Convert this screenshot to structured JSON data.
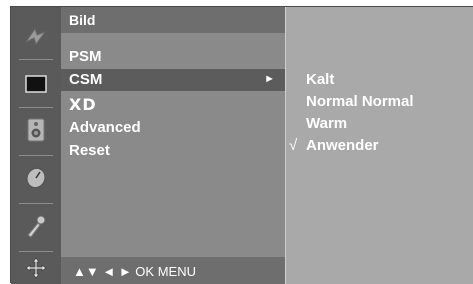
{
  "icons": [
    "picture-icon",
    "screen-icon",
    "audio-icon",
    "time-icon",
    "special-icon",
    "setup-icon"
  ],
  "menu": {
    "title": "Bild",
    "items": [
      {
        "label": "PSM",
        "selected": false,
        "arrow": ""
      },
      {
        "label": "CSM",
        "selected": true,
        "arrow": "►"
      },
      {
        "label": "XD",
        "selected": false,
        "arrow": ""
      },
      {
        "label": "Advanced",
        "selected": false,
        "arrow": ""
      },
      {
        "label": "Reset",
        "selected": false,
        "arrow": ""
      }
    ]
  },
  "submenu": {
    "items": [
      {
        "label": "Kalt",
        "checked": false
      },
      {
        "label": "Normal Normal",
        "checked": false
      },
      {
        "label": "Warm",
        "checked": false
      },
      {
        "label": "Anwender",
        "checked": true
      }
    ],
    "check_glyph": "√"
  },
  "footer": {
    "nav_hint": "▲▼  ◄ ►  OK  MENU"
  }
}
